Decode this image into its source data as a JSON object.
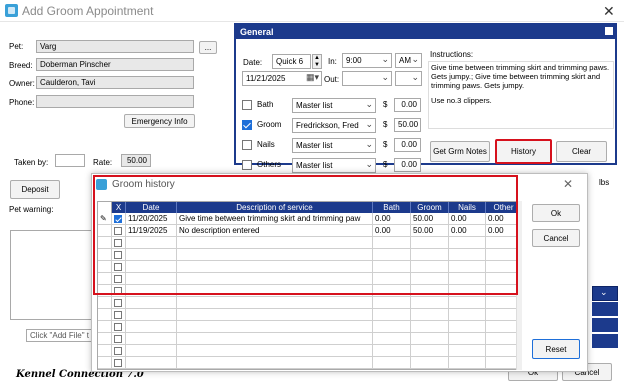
{
  "window": {
    "title": "Add Groom Appointment",
    "close": "✕"
  },
  "left": {
    "pet_label": "Pet:",
    "pet_value": "Varg",
    "browse": "...",
    "breed_label": "Breed:",
    "breed_value": "Doberman Pinscher",
    "owner_label": "Owner:",
    "owner_value": "Caulderon, Tavi",
    "phone_label": "Phone:",
    "phone_value": "",
    "emergency": "Emergency Info",
    "taken_label": "Taken by:",
    "rate_label": "Rate:",
    "rate_value": "50.00",
    "deposit": "Deposit",
    "warning_label": "Pet warning:",
    "file_hint": "Click \"Add File\" t"
  },
  "general": {
    "header": "General",
    "date_label": "Date:",
    "date_combo": "Quick 6",
    "date_value": "11/21/2025",
    "in_label": "In:",
    "in_time": "9:00",
    "in_ampm": "AM",
    "out_label": "Out:",
    "instructions_label": "Instructions:",
    "instructions_text": "Give time between trimming skirt and trimming paws. Gets jumpy.; Give time between trimming skirt and trimming paws. Gets jumpy.",
    "instructions_text2": "Use no.3 clippers.",
    "services": [
      {
        "name": "Bath",
        "checked": false,
        "who": "Master list",
        "cur": "$",
        "price": "0.00"
      },
      {
        "name": "Groom",
        "checked": true,
        "who": "Fredrickson, Fred",
        "cur": "$",
        "price": "50.00"
      },
      {
        "name": "Nails",
        "checked": false,
        "who": "Master list",
        "cur": "$",
        "price": "0.00"
      },
      {
        "name": "Others",
        "checked": false,
        "who": "Master list",
        "cur": "$",
        "price": "0.00"
      }
    ],
    "btn_notes": "Get Grm Notes",
    "btn_history": "History",
    "btn_clear": "Clear",
    "lbs": "lbs"
  },
  "history": {
    "title": "Groom history",
    "close": "✕",
    "columns": [
      "X",
      "Date",
      "Description of service",
      "Bath",
      "Groom",
      "Nails",
      "Other"
    ],
    "rows": [
      {
        "marker": "✎",
        "checked": true,
        "date": "11/20/2025",
        "desc": "Give time between trimming skirt and trimming paw",
        "bath": "0.00",
        "groom": "50.00",
        "nails": "0.00",
        "other": "0.00"
      },
      {
        "marker": "",
        "checked": false,
        "date": "11/19/2025",
        "desc": "No description entered",
        "bath": "0.00",
        "groom": "50.00",
        "nails": "0.00",
        "other": "0.00"
      }
    ],
    "ok": "Ok",
    "cancel": "Cancel",
    "reset": "Reset"
  },
  "bottom": {
    "ok": "Ok",
    "cancel": "Cancel",
    "footer": "Kennel Connection 7.0"
  },
  "colors": {
    "accent": "#1c3a8c",
    "highlight": "#d6111d",
    "check": "#1e6fd9"
  }
}
